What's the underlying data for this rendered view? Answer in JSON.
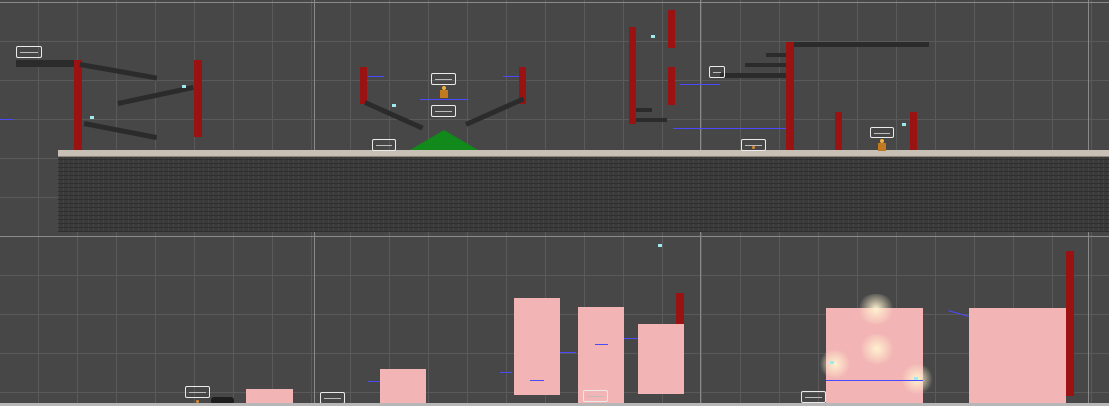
{
  "scene": {
    "view": "scene-editor",
    "colors": {
      "background": "#474747",
      "grid": "#5a5a5a",
      "pillar": "#9a1212",
      "beam": "#2b2b2b",
      "ground_top": "#c8c0b4",
      "ground_fill": "#3a3a3a",
      "ramp": "#11891b",
      "pink_zone": "#f2b4b4",
      "wire": "#4a4aff",
      "camera_gizmo": "#eaeaea"
    },
    "icons": [
      "camera-gizmo-icon",
      "player-sprite-icon",
      "vehicle-sprite-icon",
      "particle-icon"
    ]
  }
}
